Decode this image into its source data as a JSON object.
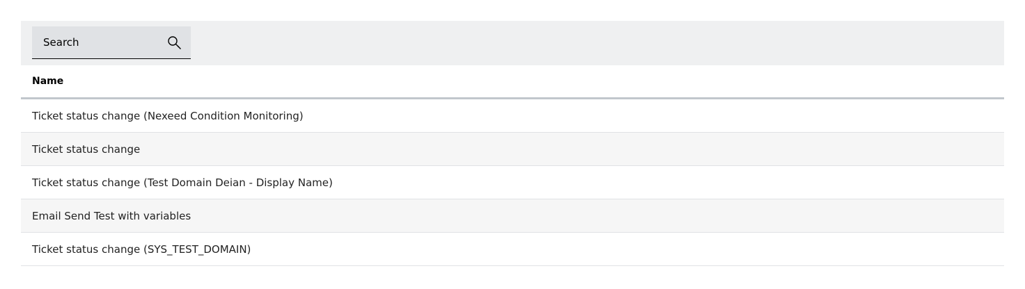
{
  "search": {
    "placeholder": "Search"
  },
  "table": {
    "columns": [
      {
        "label": "Name"
      }
    ],
    "rows": [
      {
        "name": "Ticket status change (Nexeed Condition Monitoring)"
      },
      {
        "name": "Ticket status change"
      },
      {
        "name": "Ticket status change (Test Domain Deian - Display Name)"
      },
      {
        "name": "Email Send Test with variables"
      },
      {
        "name": "Ticket status change (SYS_TEST_DOMAIN)"
      }
    ]
  },
  "icons": {
    "search": "search-icon"
  },
  "colors": {
    "toolbar_bg": "#eff0f1",
    "search_bg": "#e0e2e5",
    "header_divider": "#c1c7cc",
    "row_alt_bg": "#f6f6f6",
    "row_divider": "#e0e2e5"
  }
}
